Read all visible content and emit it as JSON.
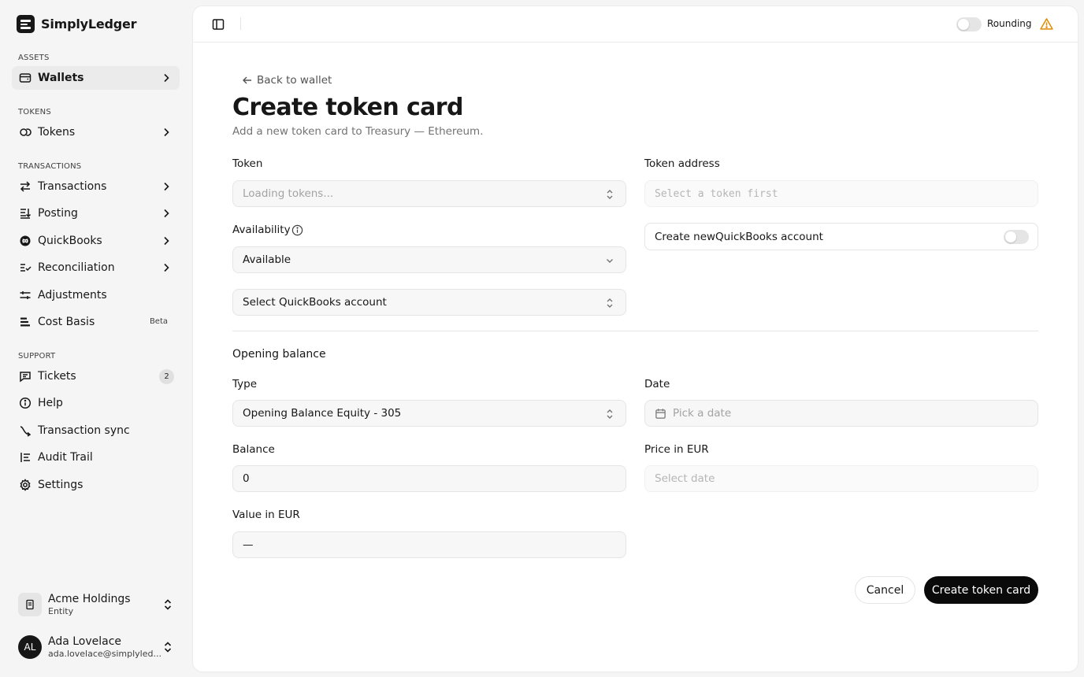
{
  "app": {
    "name": "SimplyLedger"
  },
  "sidebar": {
    "sections": {
      "assets": "ASSETS",
      "tokens": "TOKENS",
      "transactions": "TRANSACTIONS",
      "support": "SUPPORT"
    },
    "items": [
      {
        "label": "Wallets",
        "icon": "wallet-icon"
      },
      {
        "label": "Tokens",
        "icon": "tokens-icon"
      },
      {
        "label": "Transactions",
        "icon": "arrows-exchange-icon"
      },
      {
        "label": "Posting",
        "icon": "posting-icon"
      },
      {
        "label": "QuickBooks",
        "icon": "quickbooks-icon"
      },
      {
        "label": "Reconciliation",
        "icon": "reconcile-icon"
      },
      {
        "label": "Adjustments",
        "icon": "sliders-icon"
      },
      {
        "label": "Cost Basis",
        "icon": "cost-basis-icon",
        "badge": "Beta"
      },
      {
        "label": "Tickets",
        "icon": "ticket-icon",
        "count": "2"
      },
      {
        "label": "Help",
        "icon": "help-icon"
      },
      {
        "label": "Transaction sync",
        "icon": "sync-icon"
      },
      {
        "label": "Audit Trail",
        "icon": "audit-icon"
      },
      {
        "label": "Settings",
        "icon": "gear-icon"
      }
    ],
    "entity": {
      "name": "Acme Holdings",
      "sub": "Entity"
    },
    "user": {
      "initials": "AL",
      "name": "Ada Lovelace",
      "email": "ada.lovelace@simplyled..."
    }
  },
  "topbar": {
    "rounding_label": "Rounding"
  },
  "page": {
    "back_label": "Back to wallet",
    "title": "Create token card",
    "subtitle": "Add a new token card to Treasury — Ethereum."
  },
  "form": {
    "token": {
      "label": "Token",
      "placeholder": "Loading tokens..."
    },
    "token_address": {
      "label": "Token address",
      "placeholder": "Select a token first"
    },
    "availability": {
      "label": "Availability",
      "value": "Available"
    },
    "qb_account": {
      "value": "Select QuickBooks account"
    },
    "create_qb": {
      "label": "Create newQuickBooks account"
    },
    "opening_balance": {
      "title": "Opening balance",
      "type": {
        "label": "Type",
        "value": "Opening Balance Equity - 305"
      },
      "date": {
        "label": "Date",
        "placeholder": "Pick a date"
      },
      "balance": {
        "label": "Balance",
        "value": "0"
      },
      "price": {
        "label": "Price in EUR",
        "placeholder": "Select date"
      },
      "value": {
        "label": "Value in EUR",
        "value": "—"
      }
    }
  },
  "actions": {
    "cancel": "Cancel",
    "create": "Create token card"
  }
}
